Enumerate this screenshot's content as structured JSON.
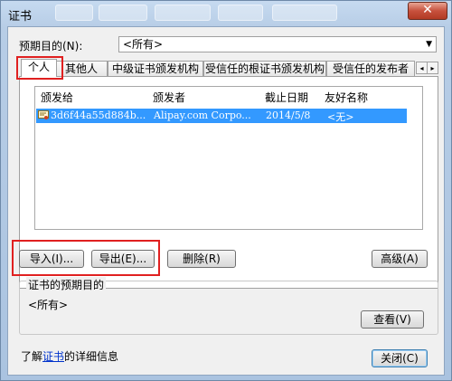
{
  "window": {
    "title": "证书",
    "close_glyph": "✕"
  },
  "purpose": {
    "label": "预期目的(N):",
    "selected": "<所有>"
  },
  "tabs": [
    {
      "label": "个人"
    },
    {
      "label": "其他人"
    },
    {
      "label": "中级证书颁发机构"
    },
    {
      "label": "受信任的根证书颁发机构"
    },
    {
      "label": "受信任的发布者"
    }
  ],
  "tab_scroll": {
    "left": "◂",
    "right": "▸"
  },
  "list": {
    "columns": [
      "颁发给",
      "颁发者",
      "截止日期",
      "友好名称"
    ],
    "rows": [
      {
        "issued_to": "3d6f44a55d884b...",
        "issuer": "Alipay.com Corpo...",
        "expiry": "2014/5/8",
        "friendly_name": "<无>"
      }
    ]
  },
  "buttons": {
    "import": "导入(I)...",
    "export": "导出(E)...",
    "remove": "删除(R)",
    "advanced": "高级(A)",
    "view": "查看(V)",
    "close": "关闭(C)"
  },
  "group": {
    "title": "证书的预期目的",
    "value": "<所有>"
  },
  "footer": {
    "prefix": "了解",
    "link": "证书",
    "suffix": "的详细信息"
  },
  "colors": {
    "selection": "#3399ff",
    "highlight": "#e02020",
    "link": "#0033cc"
  }
}
